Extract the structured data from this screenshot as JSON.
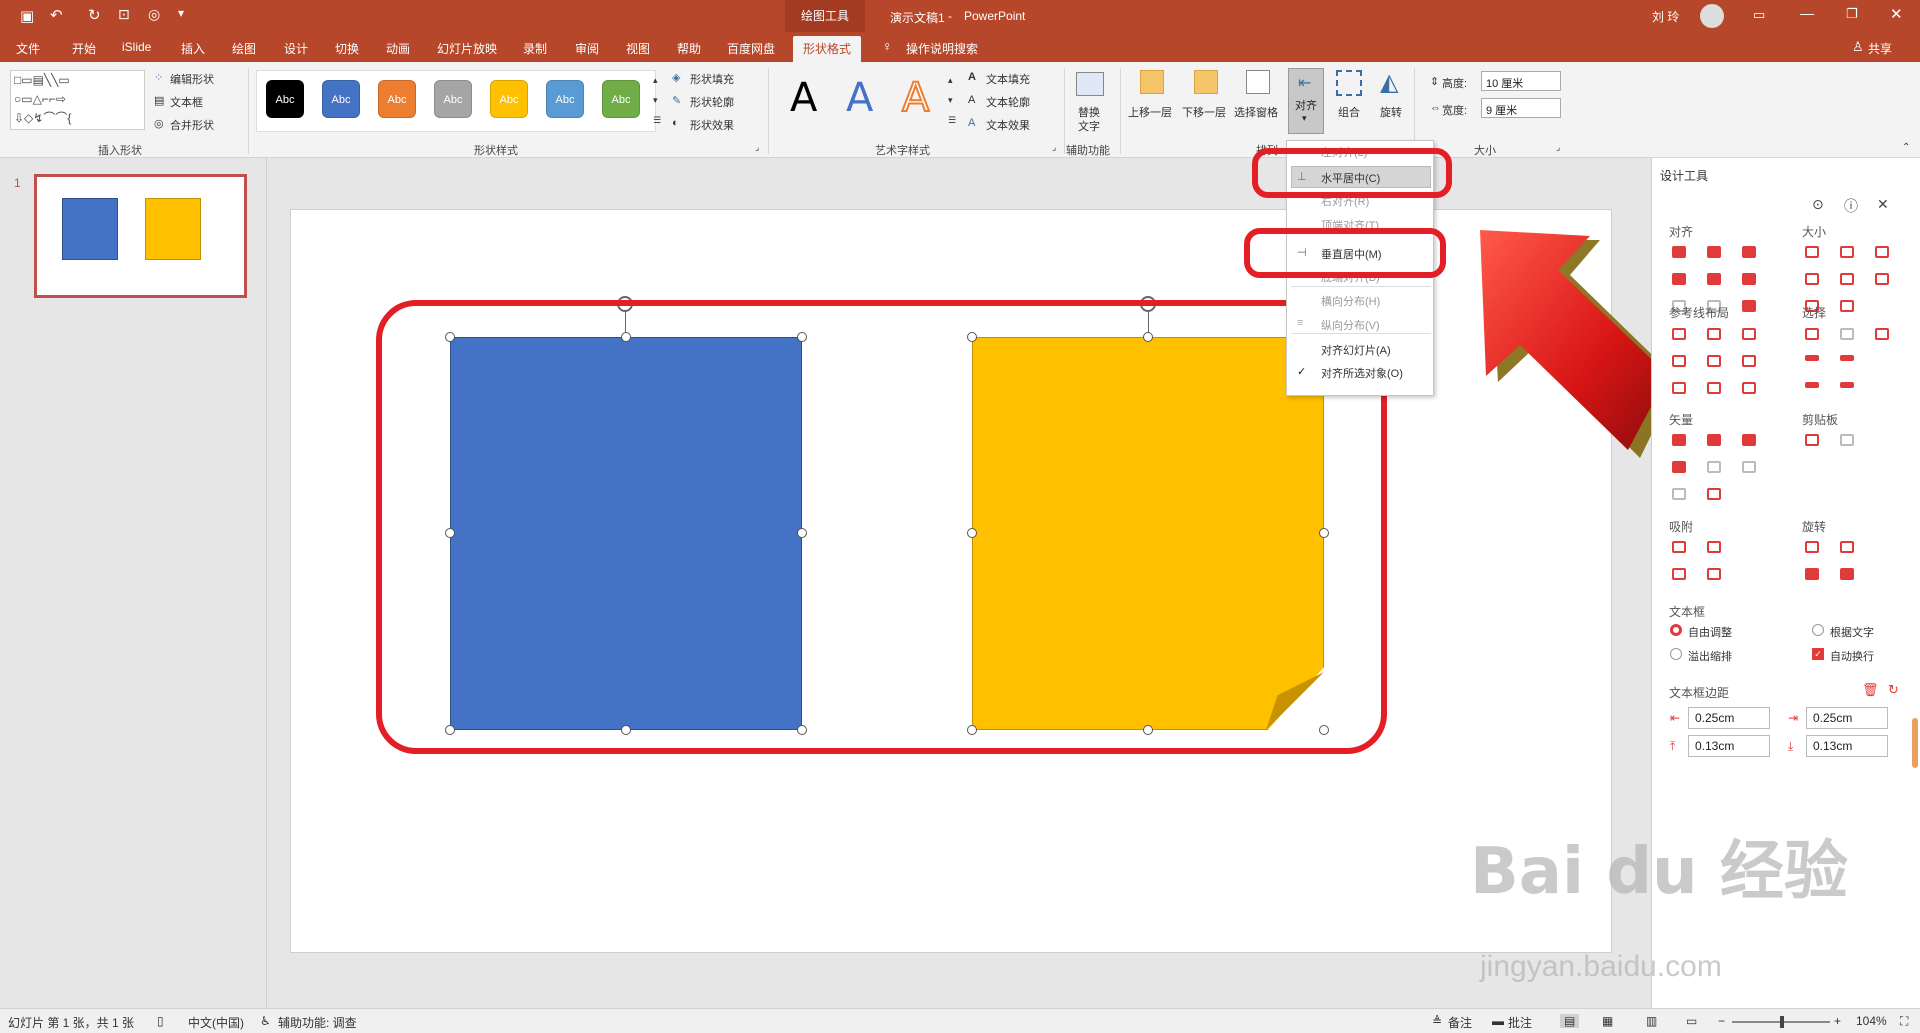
{
  "titlebar": {
    "context_tool": "绘图工具",
    "doc_title": "演示文稿1",
    "app_name": "PowerPoint",
    "user": "刘 玲"
  },
  "tabs": [
    "文件",
    "开始",
    "iSlide",
    "插入",
    "绘图",
    "设计",
    "切换",
    "动画",
    "幻灯片放映",
    "录制",
    "审阅",
    "视图",
    "帮助",
    "百度网盘",
    "形状格式"
  ],
  "active_tab": "形状格式",
  "tell_me": "操作说明搜索",
  "share": "共享",
  "ribbon": {
    "insert_shapes": {
      "label": "插入形状",
      "edit_shape": "编辑形状",
      "text_box": "文本框",
      "merge_shapes": "合并形状"
    },
    "shape_styles": {
      "label": "形状样式",
      "swatch_text": "Abc",
      "fill": "形状填充",
      "outline": "形状轮廓",
      "effects": "形状效果",
      "swatches": [
        {
          "color": "#000000"
        },
        {
          "color": "#4472c4"
        },
        {
          "color": "#ed7d31"
        },
        {
          "color": "#a5a5a5"
        },
        {
          "color": "#ffc000"
        },
        {
          "color": "#5b9bd5"
        },
        {
          "color": "#70ad47"
        }
      ]
    },
    "wordart": {
      "label": "艺术字样式",
      "glyph": "A",
      "text_fill": "文本填充",
      "text_outline": "文本轮廓",
      "text_effects": "文本效果"
    },
    "accessibility": {
      "label": "辅助功能",
      "alt_text_1": "替换",
      "alt_text_2": "文字"
    },
    "arrange": {
      "label": "排列",
      "bring_forward": "上移一层",
      "send_backward": "下移一层",
      "selection_pane": "选择窗格",
      "align": "对齐",
      "group": "组合",
      "rotate": "旋转"
    },
    "size": {
      "label": "大小",
      "height_label": "高度:",
      "height_value": "10 厘米",
      "width_label": "宽度:",
      "width_value": "9 厘米"
    }
  },
  "align_menu": {
    "items": [
      {
        "label": "左对齐(L)",
        "state": "partial"
      },
      {
        "label": "水平居中(C)",
        "state": "highlighted"
      },
      {
        "label": "右对齐(R)",
        "state": "normal"
      },
      {
        "label": "顶端对齐(T)",
        "state": "normal"
      },
      {
        "label": "垂直居中(M)",
        "state": "highlighted"
      },
      {
        "label": "底端对齐(B)",
        "state": "normal"
      },
      {
        "label": "横向分布(H)",
        "state": "disabled"
      },
      {
        "label": "纵向分布(V)",
        "state": "disabled"
      },
      {
        "label": "对齐幻灯片(A)",
        "state": "normal"
      },
      {
        "label": "对齐所选对象(O)",
        "state": "checked"
      }
    ]
  },
  "slide_panel": {
    "slide_number": "1"
  },
  "slide": {
    "shapes": [
      {
        "name": "blue-square",
        "color": "#4472c4"
      },
      {
        "name": "yellow-square",
        "color": "#ffc000"
      }
    ]
  },
  "right_pane": {
    "title": "设计工具",
    "sections": {
      "align": "对齐",
      "size": "大小",
      "guide_layout": "参考线布局",
      "select": "选择",
      "vector": "矢量",
      "clipboard": "剪贴板",
      "snap": "吸附",
      "rotate": "旋转",
      "textbox": "文本框",
      "textbox_margin": "文本框边距"
    },
    "textbox_options": {
      "auto_adjust": "自由调整",
      "fit_text": "根据文字",
      "overflow": "溢出缩排",
      "auto_wrap": "自动换行"
    },
    "margins": {
      "left": "0.25cm",
      "right": "0.25cm",
      "top": "0.13cm",
      "bottom": "0.13cm"
    }
  },
  "statusbar": {
    "slide_info": "幻灯片 第 1 张，共 1 张",
    "language": "中文(中国)",
    "accessibility": "辅助功能: 调查",
    "notes": "备注",
    "comments": "批注",
    "zoom": "104%"
  },
  "watermark": {
    "brand": "Bai du 经验",
    "url": "jingyan.baidu.com"
  },
  "colors": {
    "accent": "#b7472a",
    "highlight_red": "#e31e24"
  }
}
